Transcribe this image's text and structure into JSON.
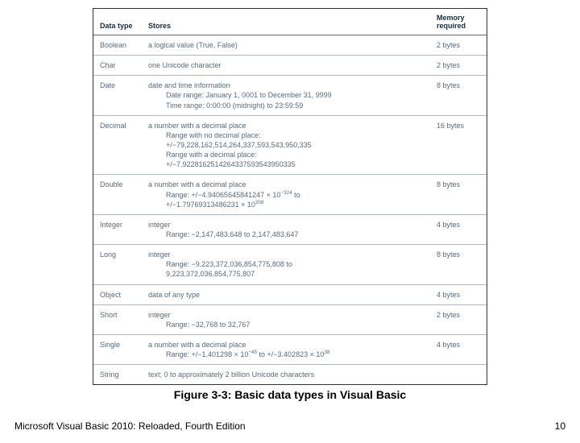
{
  "headers": {
    "type": "Data type",
    "stores": "Stores",
    "memory": "Memory required"
  },
  "rows": [
    {
      "type": "Boolean",
      "stores": "a logical value (True, False)",
      "memory": "2 bytes"
    },
    {
      "type": "Char",
      "stores": "one Unicode character",
      "memory": "2 bytes"
    },
    {
      "type": "Date",
      "stores": "date and time information",
      "sub1": "Date range: January 1, 0001 to December 31, 9999",
      "sub2": "Time range: 0:00:00 (midnight) to 23:59:59",
      "memory": "8 bytes"
    },
    {
      "type": "Decimal",
      "stores": "a number with a decimal place",
      "sub1": "Range with no decimal place:",
      "sub2": "+/−79,228,162,514,264,337,593,543,950,335",
      "sub3": "Range with a decimal place:",
      "sub4": "+/−7.9228162514264337593543950335",
      "memory": "16 bytes"
    },
    {
      "type": "Double",
      "stores": "a number with a decimal place",
      "sub1_html": "Range: +/−4.94065645841247 × 10<sup>−324</sup> to",
      "sub2_html": "+/−1.79769313486231 × 10<sup>308</sup>",
      "memory": "8 bytes"
    },
    {
      "type": "Integer",
      "stores": "integer",
      "sub1": "Range: −2,147,483,648 to 2,147,483,647",
      "memory": "4 bytes"
    },
    {
      "type": "Long",
      "stores": "integer",
      "sub1": "Range: −9,223,372,036,854,775,808 to",
      "sub2": "9,223,372,036,854,775,807",
      "memory": "8 bytes"
    },
    {
      "type": "Object",
      "stores": "data of any type",
      "memory": "4 bytes"
    },
    {
      "type": "Short",
      "stores": "integer",
      "sub1": "Range: −32,768 to 32,767",
      "memory": "2 bytes"
    },
    {
      "type": "Single",
      "stores": "a number with a decimal place",
      "sub1_html": "Range: +/−1.401298 × 10<sup>−45</sup> to +/−3.402823 × 10<sup>38</sup>",
      "memory": "4 bytes"
    },
    {
      "type": "String",
      "stores": "text; 0 to approximately 2 billion Unicode characters",
      "memory": ""
    }
  ],
  "caption": "Figure 3-3: Basic data types in Visual Basic",
  "footer": {
    "left": "Microsoft Visual Basic 2010: Reloaded, Fourth Edition",
    "right": "10"
  }
}
